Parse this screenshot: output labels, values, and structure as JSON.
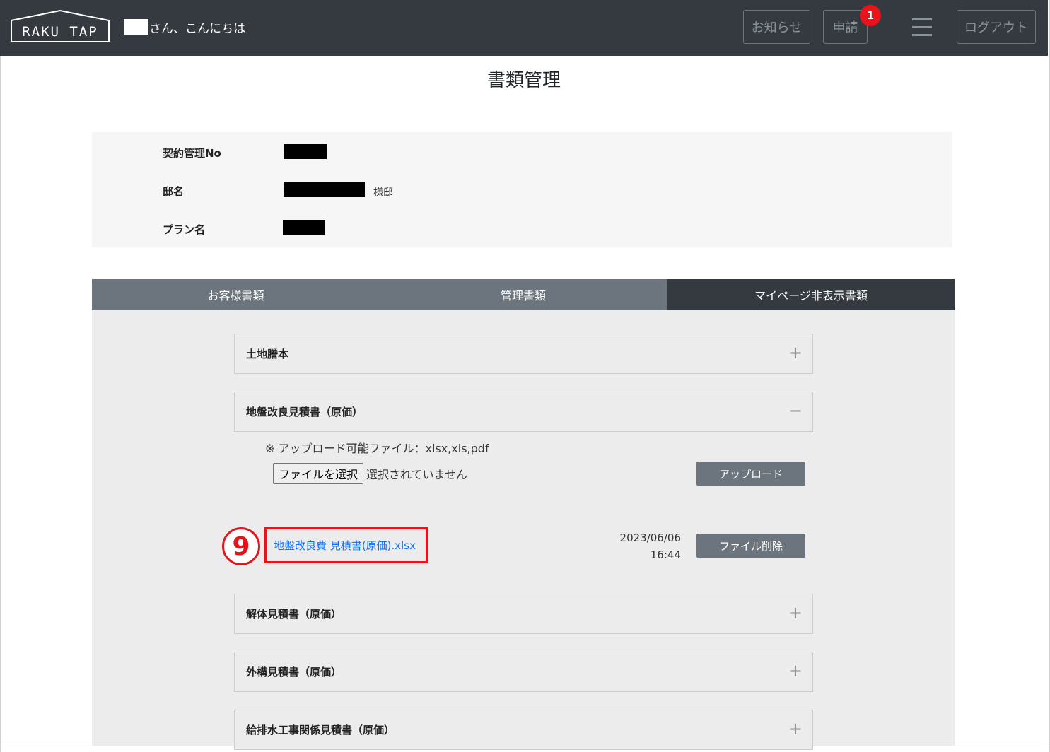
{
  "header": {
    "logo_text": "RAKU TAP",
    "greeting_suffix": "さん、こんにちは",
    "news_label": "お知らせ",
    "apply_label": "申請",
    "apply_badge": "1",
    "logout_label": "ログアウト"
  },
  "page": {
    "title": "書類管理"
  },
  "info": {
    "contract_label": "契約管理No",
    "residence_label": "邸名",
    "residence_suffix": "様邸",
    "plan_label": "プラン名"
  },
  "tabs": [
    {
      "label": "お客様書類"
    },
    {
      "label": "管理書類"
    },
    {
      "label": "マイページ非表示書類"
    }
  ],
  "sections": [
    {
      "title": "土地謄本",
      "toggle": "+"
    },
    {
      "title": "地盤改良見積書（原価）",
      "toggle": "−"
    },
    {
      "title": "解体見積書（原価）",
      "toggle": "+"
    },
    {
      "title": "外構見積書（原価）",
      "toggle": "+"
    },
    {
      "title": "給排水工事関係見積書（原価）",
      "toggle": "+"
    }
  ],
  "upload": {
    "note": "※ アップロード可能ファイル：xlsx,xls,pdf",
    "choose_label": "ファイルを選択",
    "status": "選択されていません",
    "upload_label": "アップロード"
  },
  "file": {
    "step": "9",
    "name": "地盤改良費 見積書(原価).xlsx",
    "date": "2023/06/06",
    "time": "16:44",
    "delete_label": "ファイル削除"
  }
}
